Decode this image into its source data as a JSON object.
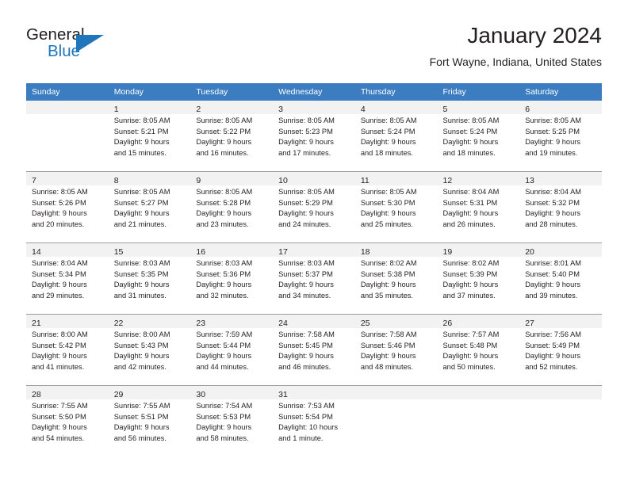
{
  "brand": {
    "word1": "General",
    "word2": "Blue",
    "flag_icon": "triangle-flag-icon",
    "accent_color": "#1f76bc"
  },
  "header": {
    "title": "January 2024",
    "subtitle": "Fort Wayne, Indiana, United States"
  },
  "calendar": {
    "header_bg": "#3b7dc0",
    "daynum_bg": "#f2f2f2",
    "weekday_headers": [
      "Sunday",
      "Monday",
      "Tuesday",
      "Wednesday",
      "Thursday",
      "Friday",
      "Saturday"
    ],
    "weeks": [
      [
        {
          "day": "",
          "lines": []
        },
        {
          "day": "1",
          "lines": [
            "Sunrise: 8:05 AM",
            "Sunset: 5:21 PM",
            "Daylight: 9 hours",
            "and 15 minutes."
          ]
        },
        {
          "day": "2",
          "lines": [
            "Sunrise: 8:05 AM",
            "Sunset: 5:22 PM",
            "Daylight: 9 hours",
            "and 16 minutes."
          ]
        },
        {
          "day": "3",
          "lines": [
            "Sunrise: 8:05 AM",
            "Sunset: 5:23 PM",
            "Daylight: 9 hours",
            "and 17 minutes."
          ]
        },
        {
          "day": "4",
          "lines": [
            "Sunrise: 8:05 AM",
            "Sunset: 5:24 PM",
            "Daylight: 9 hours",
            "and 18 minutes."
          ]
        },
        {
          "day": "5",
          "lines": [
            "Sunrise: 8:05 AM",
            "Sunset: 5:24 PM",
            "Daylight: 9 hours",
            "and 18 minutes."
          ]
        },
        {
          "day": "6",
          "lines": [
            "Sunrise: 8:05 AM",
            "Sunset: 5:25 PM",
            "Daylight: 9 hours",
            "and 19 minutes."
          ]
        }
      ],
      [
        {
          "day": "7",
          "lines": [
            "Sunrise: 8:05 AM",
            "Sunset: 5:26 PM",
            "Daylight: 9 hours",
            "and 20 minutes."
          ]
        },
        {
          "day": "8",
          "lines": [
            "Sunrise: 8:05 AM",
            "Sunset: 5:27 PM",
            "Daylight: 9 hours",
            "and 21 minutes."
          ]
        },
        {
          "day": "9",
          "lines": [
            "Sunrise: 8:05 AM",
            "Sunset: 5:28 PM",
            "Daylight: 9 hours",
            "and 23 minutes."
          ]
        },
        {
          "day": "10",
          "lines": [
            "Sunrise: 8:05 AM",
            "Sunset: 5:29 PM",
            "Daylight: 9 hours",
            "and 24 minutes."
          ]
        },
        {
          "day": "11",
          "lines": [
            "Sunrise: 8:05 AM",
            "Sunset: 5:30 PM",
            "Daylight: 9 hours",
            "and 25 minutes."
          ]
        },
        {
          "day": "12",
          "lines": [
            "Sunrise: 8:04 AM",
            "Sunset: 5:31 PM",
            "Daylight: 9 hours",
            "and 26 minutes."
          ]
        },
        {
          "day": "13",
          "lines": [
            "Sunrise: 8:04 AM",
            "Sunset: 5:32 PM",
            "Daylight: 9 hours",
            "and 28 minutes."
          ]
        }
      ],
      [
        {
          "day": "14",
          "lines": [
            "Sunrise: 8:04 AM",
            "Sunset: 5:34 PM",
            "Daylight: 9 hours",
            "and 29 minutes."
          ]
        },
        {
          "day": "15",
          "lines": [
            "Sunrise: 8:03 AM",
            "Sunset: 5:35 PM",
            "Daylight: 9 hours",
            "and 31 minutes."
          ]
        },
        {
          "day": "16",
          "lines": [
            "Sunrise: 8:03 AM",
            "Sunset: 5:36 PM",
            "Daylight: 9 hours",
            "and 32 minutes."
          ]
        },
        {
          "day": "17",
          "lines": [
            "Sunrise: 8:03 AM",
            "Sunset: 5:37 PM",
            "Daylight: 9 hours",
            "and 34 minutes."
          ]
        },
        {
          "day": "18",
          "lines": [
            "Sunrise: 8:02 AM",
            "Sunset: 5:38 PM",
            "Daylight: 9 hours",
            "and 35 minutes."
          ]
        },
        {
          "day": "19",
          "lines": [
            "Sunrise: 8:02 AM",
            "Sunset: 5:39 PM",
            "Daylight: 9 hours",
            "and 37 minutes."
          ]
        },
        {
          "day": "20",
          "lines": [
            "Sunrise: 8:01 AM",
            "Sunset: 5:40 PM",
            "Daylight: 9 hours",
            "and 39 minutes."
          ]
        }
      ],
      [
        {
          "day": "21",
          "lines": [
            "Sunrise: 8:00 AM",
            "Sunset: 5:42 PM",
            "Daylight: 9 hours",
            "and 41 minutes."
          ]
        },
        {
          "day": "22",
          "lines": [
            "Sunrise: 8:00 AM",
            "Sunset: 5:43 PM",
            "Daylight: 9 hours",
            "and 42 minutes."
          ]
        },
        {
          "day": "23",
          "lines": [
            "Sunrise: 7:59 AM",
            "Sunset: 5:44 PM",
            "Daylight: 9 hours",
            "and 44 minutes."
          ]
        },
        {
          "day": "24",
          "lines": [
            "Sunrise: 7:58 AM",
            "Sunset: 5:45 PM",
            "Daylight: 9 hours",
            "and 46 minutes."
          ]
        },
        {
          "day": "25",
          "lines": [
            "Sunrise: 7:58 AM",
            "Sunset: 5:46 PM",
            "Daylight: 9 hours",
            "and 48 minutes."
          ]
        },
        {
          "day": "26",
          "lines": [
            "Sunrise: 7:57 AM",
            "Sunset: 5:48 PM",
            "Daylight: 9 hours",
            "and 50 minutes."
          ]
        },
        {
          "day": "27",
          "lines": [
            "Sunrise: 7:56 AM",
            "Sunset: 5:49 PM",
            "Daylight: 9 hours",
            "and 52 minutes."
          ]
        }
      ],
      [
        {
          "day": "28",
          "lines": [
            "Sunrise: 7:55 AM",
            "Sunset: 5:50 PM",
            "Daylight: 9 hours",
            "and 54 minutes."
          ]
        },
        {
          "day": "29",
          "lines": [
            "Sunrise: 7:55 AM",
            "Sunset: 5:51 PM",
            "Daylight: 9 hours",
            "and 56 minutes."
          ]
        },
        {
          "day": "30",
          "lines": [
            "Sunrise: 7:54 AM",
            "Sunset: 5:53 PM",
            "Daylight: 9 hours",
            "and 58 minutes."
          ]
        },
        {
          "day": "31",
          "lines": [
            "Sunrise: 7:53 AM",
            "Sunset: 5:54 PM",
            "Daylight: 10 hours",
            "and 1 minute."
          ]
        },
        {
          "day": "",
          "lines": []
        },
        {
          "day": "",
          "lines": []
        },
        {
          "day": "",
          "lines": []
        }
      ]
    ]
  }
}
